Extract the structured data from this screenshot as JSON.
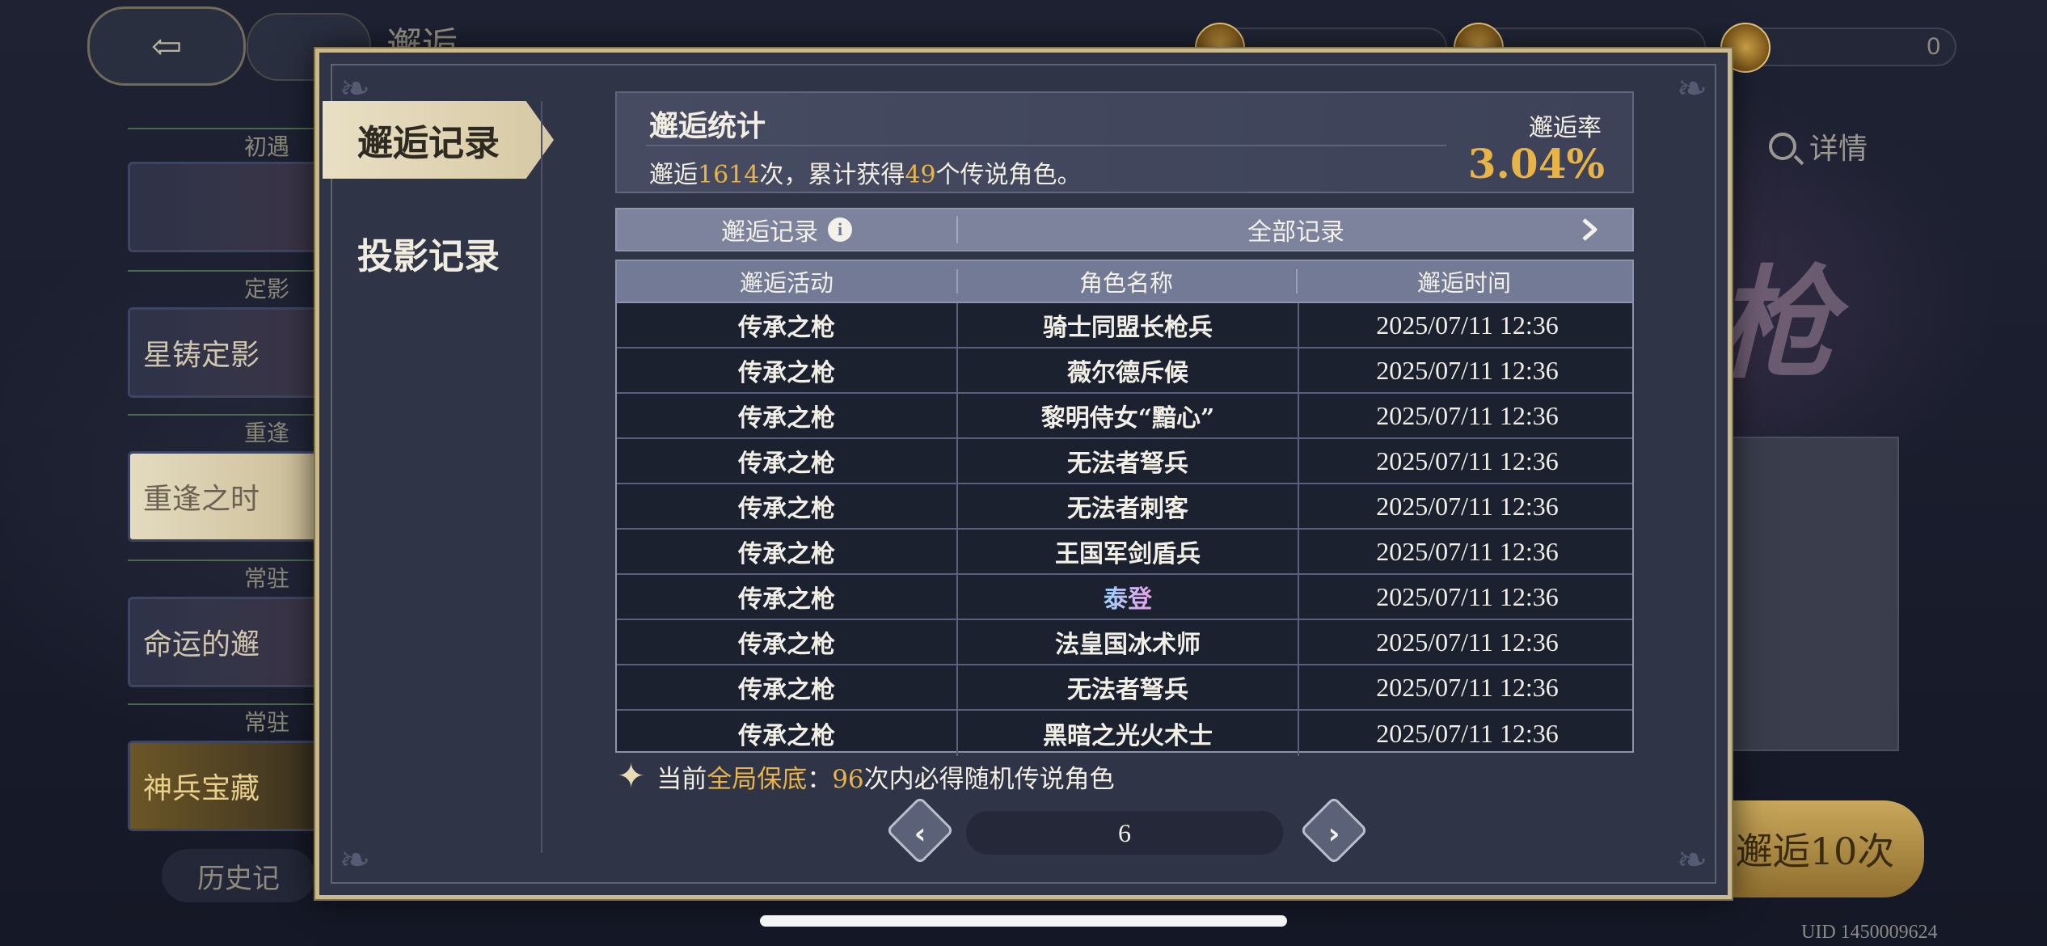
{
  "background": {
    "title": "邂逅",
    "resources": [
      "0"
    ],
    "side_banners": [
      {
        "tag": "初遇",
        "label": ""
      },
      {
        "tag": "定影",
        "label": "星铸定影"
      },
      {
        "tag": "重逢",
        "label": "重逢之时"
      },
      {
        "tag": "常驻",
        "label": "命运的邂"
      },
      {
        "tag": "常驻",
        "label": "神兵宝藏"
      }
    ],
    "detail_label": "详情",
    "big_char": "枪",
    "ten_pull_label": "邂逅10次",
    "history_label": "历史记",
    "uid": "UID 1450009624"
  },
  "dialog": {
    "tabs": [
      {
        "label": "邂逅记录",
        "active": true
      },
      {
        "label": "投影记录",
        "active": false
      }
    ],
    "stats": {
      "title": "邂逅统计",
      "desc_prefix": "邂逅",
      "pull_count": "1614",
      "desc_mid": "次，累计获得",
      "legend_count": "49",
      "desc_suffix": "个传说角色。",
      "rate_label": "邂逅率",
      "rate_value": "3.04%"
    },
    "filter": {
      "left_label": "邂逅记录",
      "info_glyph": "i",
      "right_label": "全部记录"
    },
    "table": {
      "headers": [
        "邂逅活动",
        "角色名称",
        "邂逅时间"
      ],
      "rows": [
        {
          "activity": "传承之枪",
          "name": "骑士同盟长枪兵",
          "time": "2025/07/11 12:36"
        },
        {
          "activity": "传承之枪",
          "name": "薇尔德斥候",
          "time": "2025/07/11 12:36"
        },
        {
          "activity": "传承之枪",
          "name": "黎明侍女“黯心”",
          "time": "2025/07/11 12:36"
        },
        {
          "activity": "传承之枪",
          "name": "无法者弩兵",
          "time": "2025/07/11 12:36"
        },
        {
          "activity": "传承之枪",
          "name": "无法者刺客",
          "time": "2025/07/11 12:36"
        },
        {
          "activity": "传承之枪",
          "name": "王国军剑盾兵",
          "time": "2025/07/11 12:36"
        },
        {
          "activity": "传承之枪",
          "name": "泰登",
          "time": "2025/07/11 12:36",
          "legendary": true
        },
        {
          "activity": "传承之枪",
          "name": "法皇国冰术师",
          "time": "2025/07/11 12:36"
        },
        {
          "activity": "传承之枪",
          "name": "无法者弩兵",
          "time": "2025/07/11 12:36"
        },
        {
          "activity": "传承之枪",
          "name": "黑暗之光火术士",
          "time": "2025/07/11 12:36"
        }
      ]
    },
    "pity": {
      "prefix": "当前",
      "highlight": "全局保底",
      "colon": "：",
      "count": "96",
      "suffix": "次内必得随机传说角色"
    },
    "pagination": {
      "page": "6"
    }
  }
}
